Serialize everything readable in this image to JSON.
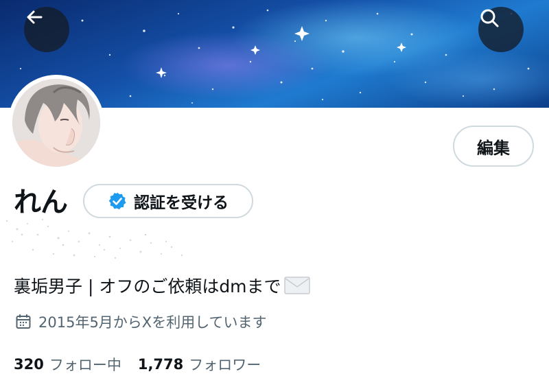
{
  "header": {
    "back_icon": "arrow-left-icon",
    "search_icon": "search-icon",
    "banner_image": "starry-night-sky",
    "button_bg": "#141c28"
  },
  "profile": {
    "avatar": "anime-boy-avatar",
    "name": "れん",
    "verify_label": "認証を受ける",
    "verify_icon": "verified-badge-icon",
    "verify_color": "#1d9bf0",
    "edit_label": "編集",
    "bio": "裏垢男子 | オフのご依頼はdmまで",
    "bio_emoji": "envelope-icon",
    "joined_icon": "calendar-icon",
    "joined": "2015年5月からXを利用しています",
    "following_count": "320",
    "following_label": "フォロー中",
    "followers_count": "1,778",
    "followers_label": "フォロワー"
  }
}
